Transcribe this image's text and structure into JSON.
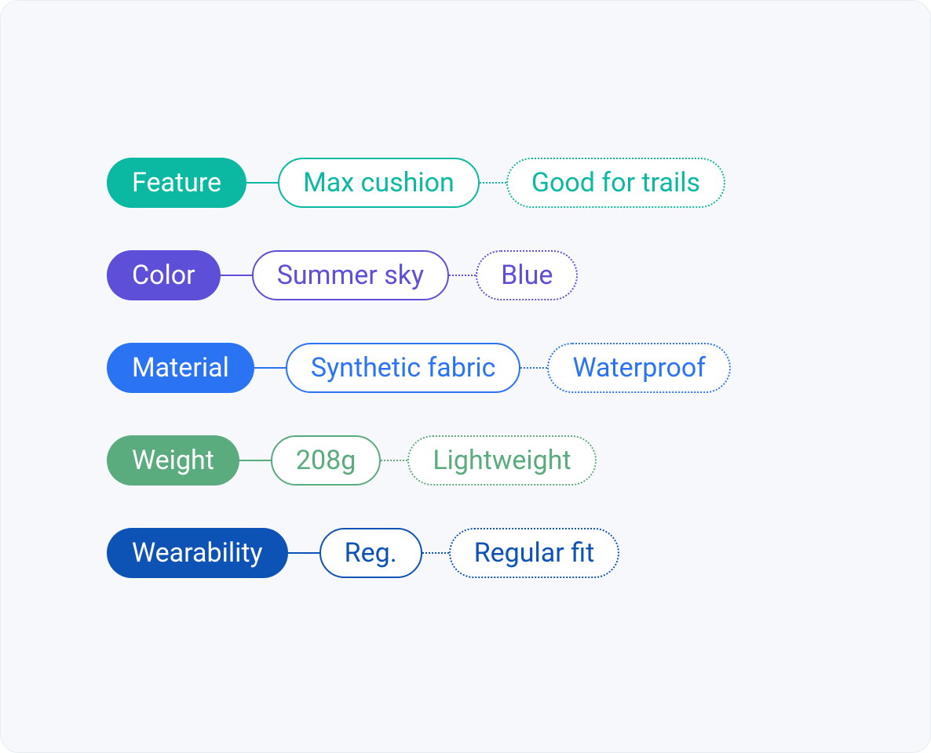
{
  "rows": [
    {
      "name": "feature",
      "color": "#0bb8a1",
      "label": "Feature",
      "value": "Max cushion",
      "extra": "Good for trails"
    },
    {
      "name": "color",
      "color": "#5e4fd8",
      "label": "Color",
      "value": "Summer sky",
      "extra": "Blue"
    },
    {
      "name": "material",
      "color": "#2a74f3",
      "label": "Material",
      "value": "Synthetic fabric",
      "extra": "Waterproof"
    },
    {
      "name": "weight",
      "color": "#5aab7d",
      "label": "Weight",
      "value": "208g",
      "extra": "Lightweight"
    },
    {
      "name": "wearability",
      "color": "#0d52b5",
      "label": "Wearability",
      "value": "Reg.",
      "extra": "Regular fit"
    }
  ]
}
